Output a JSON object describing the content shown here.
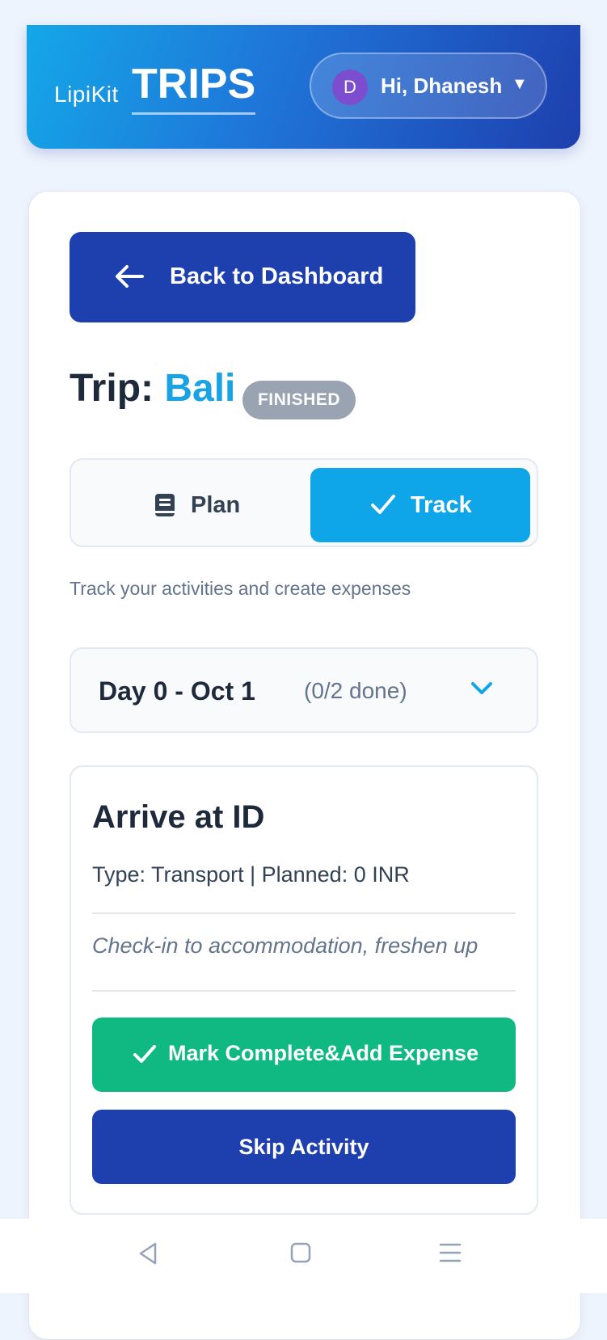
{
  "header": {
    "brand_small": "LipiKit",
    "brand_big": "TRIPS",
    "user_initial": "D",
    "greeting": "Hi, Dhanesh",
    "caret": "▼"
  },
  "back_button": {
    "label": "Back to Dashboard",
    "icon": "arrow-left-icon"
  },
  "trip": {
    "prefix": "Trip:",
    "name": "Bali",
    "status": "FINISHED"
  },
  "tabs": [
    {
      "label": "Plan",
      "icon": "book-icon",
      "active": false
    },
    {
      "label": "Track",
      "icon": "check-icon",
      "active": true
    }
  ],
  "subtitle": "Track your activities and create expenses",
  "day_selector": {
    "label": "Day 0 - Oct 1",
    "progress": "(0/2 done)",
    "icon": "chevron-down-icon"
  },
  "activity": {
    "title": "Arrive at ID",
    "meta": "Type: Transport | Planned: 0 INR",
    "description": "Check-in to accommodation, freshen up",
    "complete_label": "Mark Complete&Add Expense",
    "skip_label": "Skip Activity"
  },
  "colors": {
    "primary": "#1e3fae",
    "accent": "#0ea5e9",
    "success": "#10b981",
    "badge": "#9aa3b2"
  }
}
